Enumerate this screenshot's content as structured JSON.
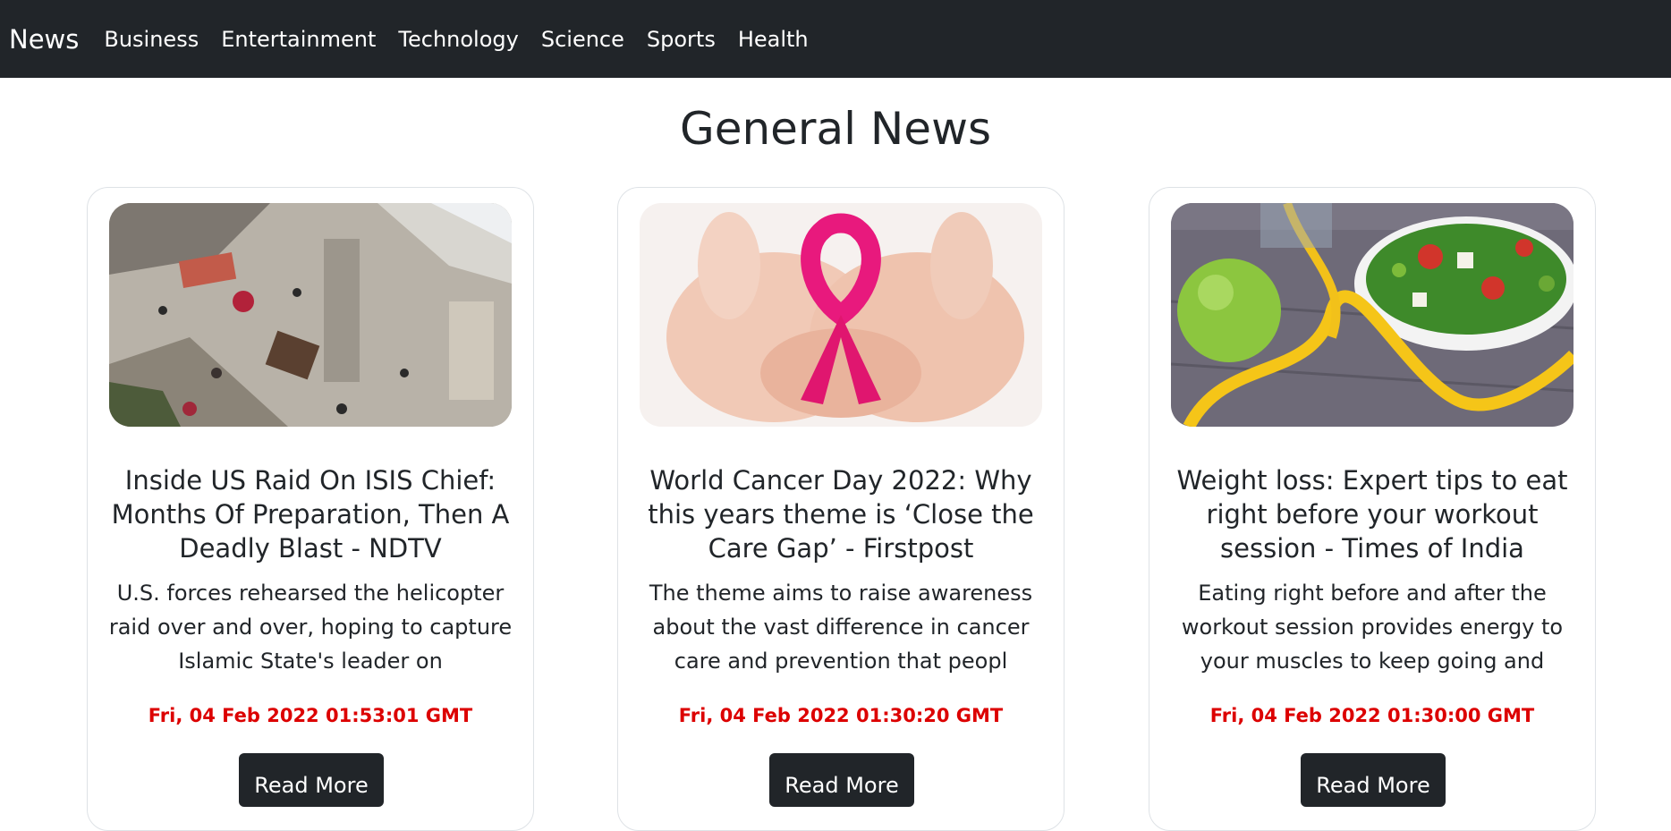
{
  "navbar": {
    "brand": "News",
    "links": [
      "Business",
      "Entertainment",
      "Technology",
      "Science",
      "Sports",
      "Health"
    ]
  },
  "page": {
    "heading": "General News"
  },
  "articles": [
    {
      "title": "Inside US Raid On ISIS Chief: Months Of Preparation, Then A Deadly Blast - NDTV",
      "description": "U.S. forces rehearsed the helicopter raid over and over, hoping to capture Islamic State's leader on",
      "date": "Fri, 04 Feb 2022 01:53:01 GMT",
      "button": "Read More",
      "image": "aerial-rubble-photo"
    },
    {
      "title": "World Cancer Day 2022: Why this years theme is ‘Close the Care Gap’ - Firstpost",
      "description": "The theme aims to raise awareness about the vast difference in cancer care and prevention that peopl",
      "date": "Fri, 04 Feb 2022 01:30:20 GMT",
      "button": "Read More",
      "image": "pink-ribbon-hands-photo"
    },
    {
      "title": "Weight loss: Expert tips to eat right before your workout session - Times of India",
      "description": "Eating right before and after the workout session provides energy to your muscles to keep going and",
      "date": "Fri, 04 Feb 2022 01:30:00 GMT",
      "button": "Read More",
      "image": "salad-apple-tape-photo"
    }
  ],
  "colors": {
    "navbar_bg": "#212529",
    "date_red": "#dc0000",
    "button_bg": "#212529"
  }
}
